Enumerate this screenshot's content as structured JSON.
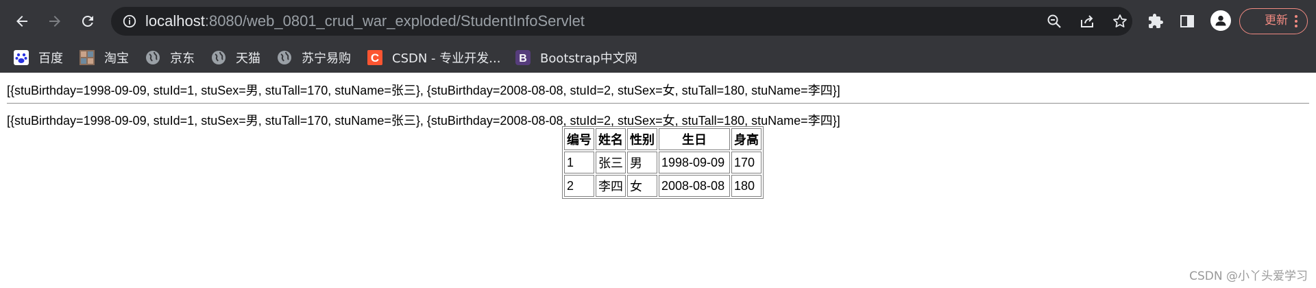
{
  "browser": {
    "url_host": "localhost",
    "url_path": ":8080/web_0801_crud_war_exploded/StudentInfoServlet",
    "update_label": "更新",
    "bookmarks": [
      {
        "label": "百度",
        "icon": "baidu-paw-icon"
      },
      {
        "label": "淘宝",
        "icon": "taobao-icon"
      },
      {
        "label": "京东",
        "icon": "globe-icon"
      },
      {
        "label": "天猫",
        "icon": "globe-icon"
      },
      {
        "label": "苏宁易购",
        "icon": "globe-icon"
      },
      {
        "label": "CSDN - 专业开发...",
        "icon": "csdn-icon"
      },
      {
        "label": "Bootstrap中文网",
        "icon": "bootstrap-icon"
      }
    ],
    "colors": {
      "chrome": "#35363a",
      "omnibox": "#202124",
      "update_accent": "#f28b82"
    }
  },
  "page": {
    "line1": "[{stuBirthday=1998-09-09, stuId=1, stuSex=男, stuTall=170, stuName=张三}, {stuBirthday=2008-08-08, stuId=2, stuSex=女, stuTall=180, stuName=李四}]",
    "line2": "[{stuBirthday=1998-09-09, stuId=1, stuSex=男, stuTall=170, stuName=张三}, {stuBirthday=2008-08-08, stuId=2, stuSex=女, stuTall=180, stuName=李四}]",
    "table": {
      "headers": [
        "编号",
        "姓名",
        "性别",
        "生日",
        "身高"
      ],
      "rows": [
        [
          "1",
          "张三",
          "男",
          "1998-09-09",
          "170"
        ],
        [
          "2",
          "李四",
          "女",
          "2008-08-08",
          "180"
        ]
      ]
    },
    "watermark": "CSDN @小丫头爱学习"
  }
}
